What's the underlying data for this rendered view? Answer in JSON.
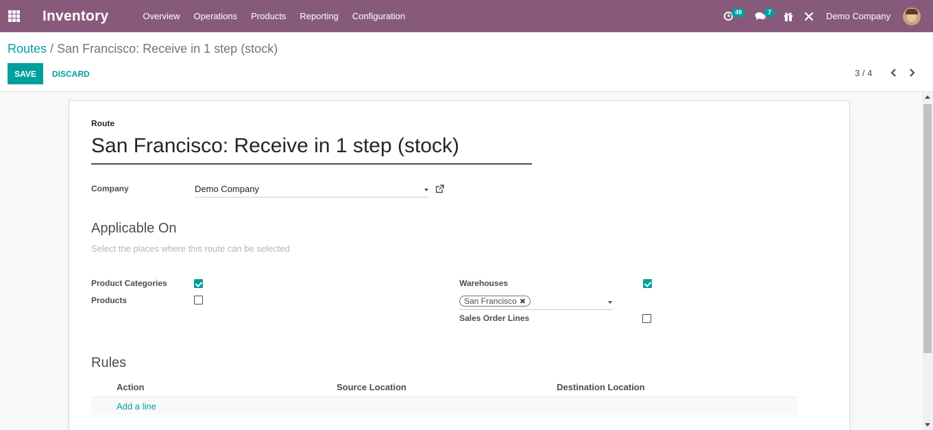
{
  "navbar": {
    "app_name": "Inventory",
    "menu": [
      "Overview",
      "Operations",
      "Products",
      "Reporting",
      "Configuration"
    ],
    "activity_count": "49",
    "messages_count": "7",
    "company": "Demo Company"
  },
  "breadcrumb": {
    "parent": "Routes",
    "separator": "/",
    "current": "San Francisco: Receive in 1 step (stock)"
  },
  "buttons": {
    "save": "Save",
    "discard": "DISCARD"
  },
  "pager": {
    "value": "3 / 4"
  },
  "form": {
    "route_label": "Route",
    "route_name": "San Francisco: Receive in 1 step (stock)",
    "company_label": "Company",
    "company_value": "Demo Company",
    "applicable_title": "Applicable On",
    "applicable_help": "Select the places where this route can be selected",
    "product_categories_label": "Product Categories",
    "product_categories_checked": true,
    "products_label": "Products",
    "products_checked": false,
    "warehouses_label": "Warehouses",
    "warehouses_checked": true,
    "warehouse_tag": "San Francisco",
    "sales_order_lines_label": "Sales Order Lines",
    "sales_order_lines_checked": false,
    "rules_title": "Rules",
    "rules_columns": [
      "Action",
      "Source Location",
      "Destination Location"
    ],
    "add_line": "Add a line"
  },
  "colors": {
    "navbar": "#875a7b",
    "accent": "#00a09d"
  }
}
